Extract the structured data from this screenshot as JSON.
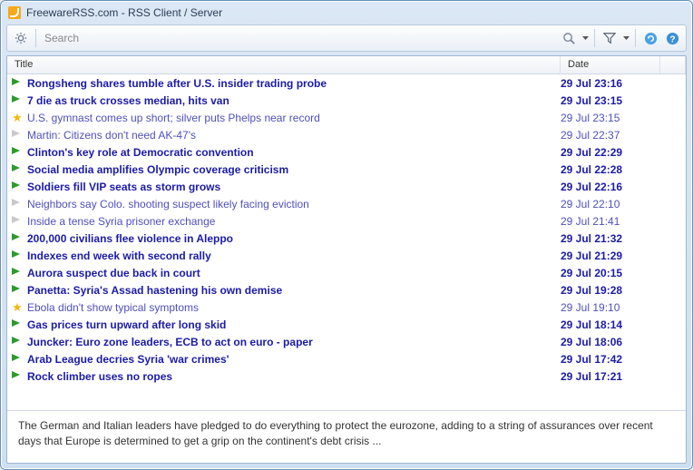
{
  "window": {
    "title": "FreewareRSS.com - RSS Client / Server"
  },
  "toolbar": {
    "search_placeholder": "Search"
  },
  "columns": {
    "title": "Title",
    "date": "Date"
  },
  "items": [
    {
      "icon": "flag-green",
      "bold": true,
      "title": "Rongsheng shares tumble after U.S. insider trading probe",
      "date": "29 Jul 23:16"
    },
    {
      "icon": "flag-green",
      "bold": true,
      "title": "7 die as truck crosses median, hits van",
      "date": "29 Jul 23:15"
    },
    {
      "icon": "star",
      "bold": false,
      "title": "U.S. gymnast comes up short; silver puts Phelps near record",
      "date": "29 Jul 23:15"
    },
    {
      "icon": "flag-grey",
      "bold": false,
      "title": "Martin: Citizens don't need AK-47's",
      "date": "29 Jul 22:37"
    },
    {
      "icon": "flag-green",
      "bold": true,
      "title": "Clinton's key role at Democratic convention",
      "date": "29 Jul 22:29"
    },
    {
      "icon": "flag-green",
      "bold": true,
      "title": "Social media amplifies Olympic coverage criticism",
      "date": "29 Jul 22:28"
    },
    {
      "icon": "flag-green",
      "bold": true,
      "title": "Soldiers fill VIP seats as storm grows",
      "date": "29 Jul 22:16"
    },
    {
      "icon": "flag-grey",
      "bold": false,
      "title": "Neighbors say Colo. shooting suspect likely facing eviction",
      "date": "29 Jul 22:10"
    },
    {
      "icon": "flag-grey",
      "bold": false,
      "title": "Inside a tense Syria prisoner exchange",
      "date": "29 Jul 21:41"
    },
    {
      "icon": "flag-green",
      "bold": true,
      "title": "200,000 civilians flee violence in Aleppo",
      "date": "29 Jul 21:32"
    },
    {
      "icon": "flag-green",
      "bold": true,
      "title": "Indexes end week with second rally",
      "date": "29 Jul 21:29"
    },
    {
      "icon": "flag-green",
      "bold": true,
      "title": "Aurora suspect due back in court",
      "date": "29 Jul 20:15"
    },
    {
      "icon": "flag-green",
      "bold": true,
      "title": "Panetta: Syria's Assad hastening his own demise",
      "date": "29 Jul 19:28"
    },
    {
      "icon": "star",
      "bold": false,
      "title": "Ebola didn't show typical symptoms",
      "date": "29 Jul 19:10"
    },
    {
      "icon": "flag-green",
      "bold": true,
      "title": "Gas prices turn upward after long skid",
      "date": "29 Jul 18:14"
    },
    {
      "icon": "flag-green",
      "bold": true,
      "title": "Juncker: Euro zone leaders, ECB to act on euro - paper",
      "date": "29 Jul 18:06"
    },
    {
      "icon": "flag-green",
      "bold": true,
      "title": "Arab League decries Syria 'war crimes'",
      "date": "29 Jul 17:42"
    },
    {
      "icon": "flag-green",
      "bold": true,
      "title": "Rock climber uses no ropes",
      "date": "29 Jul 17:21"
    }
  ],
  "preview": "The German and Italian leaders have pledged to do everything to protect the eurozone, adding to a string of assurances over recent days that Europe is determined to get a grip on the continent's debt crisis ..."
}
